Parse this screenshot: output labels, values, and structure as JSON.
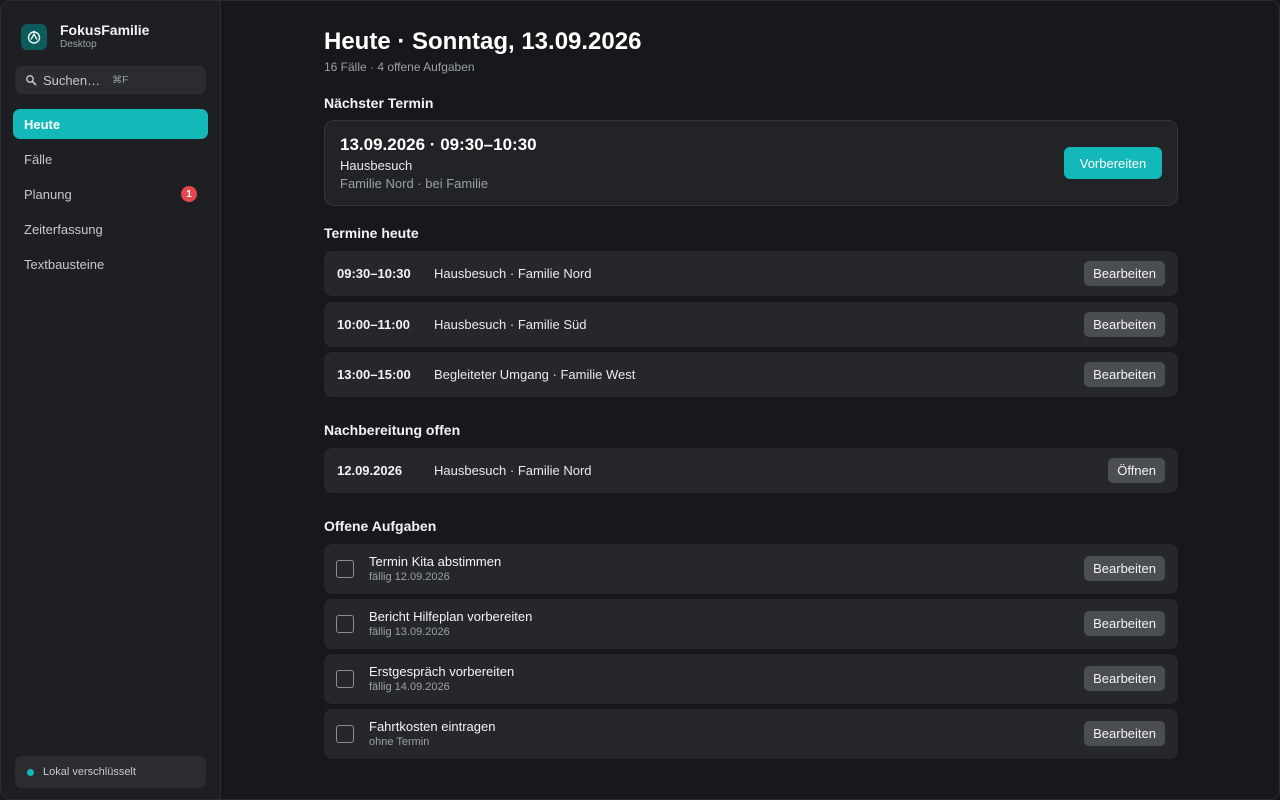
{
  "app": {
    "title": "FokusFamilie",
    "subtitle": "Desktop",
    "logo_icon": "family-logo-icon",
    "accent_color": "#13b8b8"
  },
  "search": {
    "placeholder": "Suchen…",
    "shortcut": "⌘F",
    "icon": "search-icon"
  },
  "sidebar": {
    "items": [
      {
        "label": "Heute",
        "active": true
      },
      {
        "label": "Fälle",
        "active": false
      },
      {
        "label": "Planung",
        "active": false,
        "badge": "1"
      },
      {
        "label": "Zeiterfassung",
        "active": false
      },
      {
        "label": "Textbausteine",
        "active": false
      }
    ],
    "status": "Lokal verschlüsselt"
  },
  "header": {
    "title": "Heute · Sonntag, 13.09.2026",
    "subtitle": "16 Fälle · 4 offene Aufgaben"
  },
  "next_appointment": {
    "heading": "Nächster Termin",
    "when": "13.09.2026 · 09:30–10:30",
    "type": "Hausbesuch",
    "family": "Familie Nord · bei Familie",
    "action": "Vorbereiten"
  },
  "today": {
    "heading": "Termine heute",
    "items": [
      {
        "time": "09:30–10:30",
        "desc": "Hausbesuch · Familie Nord",
        "action": "Bearbeiten"
      },
      {
        "time": "10:00–11:00",
        "desc": "Hausbesuch · Familie Süd",
        "action": "Bearbeiten"
      },
      {
        "time": "13:00–15:00",
        "desc": "Begleiteter Umgang · Familie West",
        "action": "Bearbeiten"
      }
    ]
  },
  "followup": {
    "heading": "Nachbereitung offen",
    "items": [
      {
        "date": "12.09.2026",
        "desc": "Hausbesuch · Familie Nord",
        "action": "Öffnen"
      }
    ]
  },
  "tasks": {
    "heading": "Offene Aufgaben",
    "items": [
      {
        "title": "Termin Kita abstimmen",
        "due": "fällig 12.09.2026",
        "action": "Bearbeiten",
        "done": false
      },
      {
        "title": "Bericht Hilfeplan vorbereiten",
        "due": "fällig 13.09.2026",
        "action": "Bearbeiten",
        "done": false
      },
      {
        "title": "Erstgespräch vorbereiten",
        "due": "fällig 14.09.2026",
        "action": "Bearbeiten",
        "done": false
      },
      {
        "title": "Fahrtkosten eintragen",
        "due": "ohne Termin",
        "action": "Bearbeiten",
        "done": false
      }
    ]
  }
}
